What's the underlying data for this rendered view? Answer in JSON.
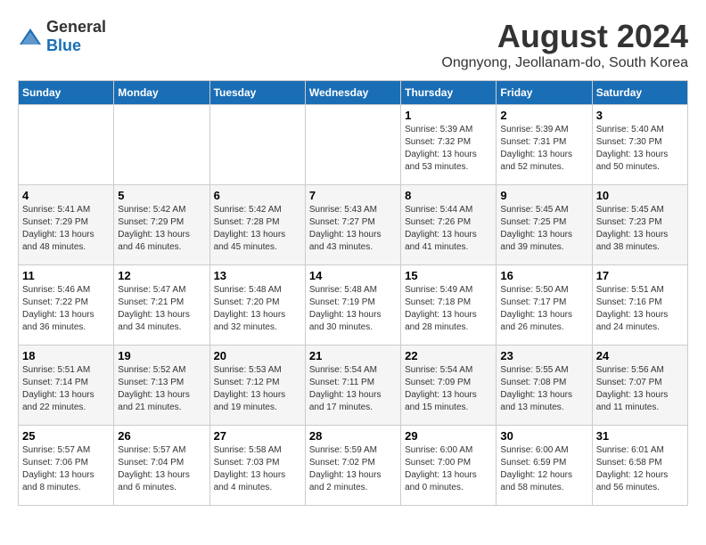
{
  "header": {
    "logo_general": "General",
    "logo_blue": "Blue",
    "main_title": "August 2024",
    "subtitle": "Ongnyong, Jeollanam-do, South Korea"
  },
  "weekdays": [
    "Sunday",
    "Monday",
    "Tuesday",
    "Wednesday",
    "Thursday",
    "Friday",
    "Saturday"
  ],
  "weeks": [
    [
      {
        "day": "",
        "info": ""
      },
      {
        "day": "",
        "info": ""
      },
      {
        "day": "",
        "info": ""
      },
      {
        "day": "",
        "info": ""
      },
      {
        "day": "1",
        "info": "Sunrise: 5:39 AM\nSunset: 7:32 PM\nDaylight: 13 hours and 53 minutes."
      },
      {
        "day": "2",
        "info": "Sunrise: 5:39 AM\nSunset: 7:31 PM\nDaylight: 13 hours and 52 minutes."
      },
      {
        "day": "3",
        "info": "Sunrise: 5:40 AM\nSunset: 7:30 PM\nDaylight: 13 hours and 50 minutes."
      }
    ],
    [
      {
        "day": "4",
        "info": "Sunrise: 5:41 AM\nSunset: 7:29 PM\nDaylight: 13 hours and 48 minutes."
      },
      {
        "day": "5",
        "info": "Sunrise: 5:42 AM\nSunset: 7:29 PM\nDaylight: 13 hours and 46 minutes."
      },
      {
        "day": "6",
        "info": "Sunrise: 5:42 AM\nSunset: 7:28 PM\nDaylight: 13 hours and 45 minutes."
      },
      {
        "day": "7",
        "info": "Sunrise: 5:43 AM\nSunset: 7:27 PM\nDaylight: 13 hours and 43 minutes."
      },
      {
        "day": "8",
        "info": "Sunrise: 5:44 AM\nSunset: 7:26 PM\nDaylight: 13 hours and 41 minutes."
      },
      {
        "day": "9",
        "info": "Sunrise: 5:45 AM\nSunset: 7:25 PM\nDaylight: 13 hours and 39 minutes."
      },
      {
        "day": "10",
        "info": "Sunrise: 5:45 AM\nSunset: 7:23 PM\nDaylight: 13 hours and 38 minutes."
      }
    ],
    [
      {
        "day": "11",
        "info": "Sunrise: 5:46 AM\nSunset: 7:22 PM\nDaylight: 13 hours and 36 minutes."
      },
      {
        "day": "12",
        "info": "Sunrise: 5:47 AM\nSunset: 7:21 PM\nDaylight: 13 hours and 34 minutes."
      },
      {
        "day": "13",
        "info": "Sunrise: 5:48 AM\nSunset: 7:20 PM\nDaylight: 13 hours and 32 minutes."
      },
      {
        "day": "14",
        "info": "Sunrise: 5:48 AM\nSunset: 7:19 PM\nDaylight: 13 hours and 30 minutes."
      },
      {
        "day": "15",
        "info": "Sunrise: 5:49 AM\nSunset: 7:18 PM\nDaylight: 13 hours and 28 minutes."
      },
      {
        "day": "16",
        "info": "Sunrise: 5:50 AM\nSunset: 7:17 PM\nDaylight: 13 hours and 26 minutes."
      },
      {
        "day": "17",
        "info": "Sunrise: 5:51 AM\nSunset: 7:16 PM\nDaylight: 13 hours and 24 minutes."
      }
    ],
    [
      {
        "day": "18",
        "info": "Sunrise: 5:51 AM\nSunset: 7:14 PM\nDaylight: 13 hours and 22 minutes."
      },
      {
        "day": "19",
        "info": "Sunrise: 5:52 AM\nSunset: 7:13 PM\nDaylight: 13 hours and 21 minutes."
      },
      {
        "day": "20",
        "info": "Sunrise: 5:53 AM\nSunset: 7:12 PM\nDaylight: 13 hours and 19 minutes."
      },
      {
        "day": "21",
        "info": "Sunrise: 5:54 AM\nSunset: 7:11 PM\nDaylight: 13 hours and 17 minutes."
      },
      {
        "day": "22",
        "info": "Sunrise: 5:54 AM\nSunset: 7:09 PM\nDaylight: 13 hours and 15 minutes."
      },
      {
        "day": "23",
        "info": "Sunrise: 5:55 AM\nSunset: 7:08 PM\nDaylight: 13 hours and 13 minutes."
      },
      {
        "day": "24",
        "info": "Sunrise: 5:56 AM\nSunset: 7:07 PM\nDaylight: 13 hours and 11 minutes."
      }
    ],
    [
      {
        "day": "25",
        "info": "Sunrise: 5:57 AM\nSunset: 7:06 PM\nDaylight: 13 hours and 8 minutes."
      },
      {
        "day": "26",
        "info": "Sunrise: 5:57 AM\nSunset: 7:04 PM\nDaylight: 13 hours and 6 minutes."
      },
      {
        "day": "27",
        "info": "Sunrise: 5:58 AM\nSunset: 7:03 PM\nDaylight: 13 hours and 4 minutes."
      },
      {
        "day": "28",
        "info": "Sunrise: 5:59 AM\nSunset: 7:02 PM\nDaylight: 13 hours and 2 minutes."
      },
      {
        "day": "29",
        "info": "Sunrise: 6:00 AM\nSunset: 7:00 PM\nDaylight: 13 hours and 0 minutes."
      },
      {
        "day": "30",
        "info": "Sunrise: 6:00 AM\nSunset: 6:59 PM\nDaylight: 12 hours and 58 minutes."
      },
      {
        "day": "31",
        "info": "Sunrise: 6:01 AM\nSunset: 6:58 PM\nDaylight: 12 hours and 56 minutes."
      }
    ]
  ]
}
